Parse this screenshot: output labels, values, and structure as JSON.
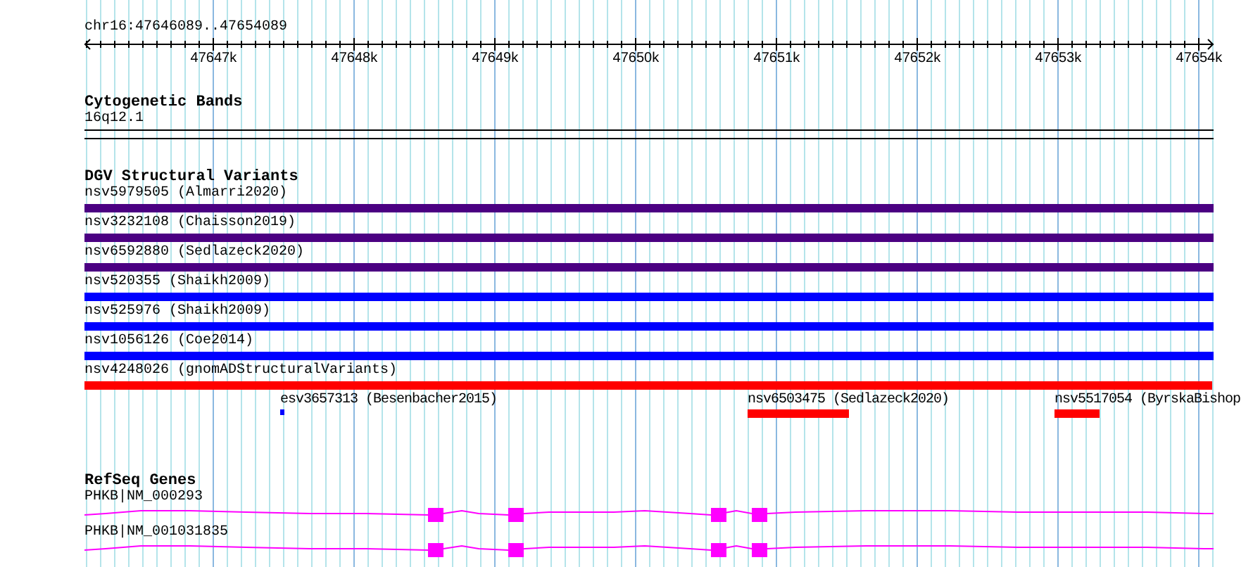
{
  "scale": {
    "location": "chr16:47646089..47654089",
    "ticks": [
      "47647k",
      "47648k",
      "47649k",
      "47650k",
      "47651k",
      "47652k",
      "47653k",
      "47654k"
    ]
  },
  "tracks": [
    {
      "kind": "cytoband",
      "title": "Cytogenetic Bands",
      "bands": [
        {
          "label": "16q12.1"
        }
      ]
    },
    {
      "kind": "variants",
      "title": "DGV Structural Variants",
      "rows": [
        [
          {
            "label": "nsv5979505 (Almarri2020)",
            "color": "#4b0082"
          }
        ],
        [
          {
            "label": "nsv3232108 (Chaisson2019)",
            "color": "#4b0082"
          }
        ],
        [
          {
            "label": "nsv6592880 (Sedlazeck2020)",
            "color": "#4b0082"
          }
        ],
        [
          {
            "label": "nsv520355 (Shaikh2009)",
            "color": "#0000ff"
          }
        ],
        [
          {
            "label": "nsv525976 (Shaikh2009)",
            "color": "#0000ff"
          }
        ],
        [
          {
            "label": "nsv1056126 (Coe2014)",
            "color": "#0000ff"
          }
        ],
        [
          {
            "label": "nsv4248026 (gnomADStructuralVariants)",
            "color": "#ff0000"
          }
        ],
        [
          {
            "label": "esv3657313 (Besenbacher2015)",
            "color": "#0000ff"
          },
          {
            "label": "nsv6503475 (Sedlazeck2020)",
            "color": "#ff0000"
          },
          {
            "label": "nsv5517054 (ByrskaBishop",
            "color": "#ff0000"
          }
        ]
      ]
    },
    {
      "kind": "genes",
      "title": "RefSeq Genes",
      "genes": [
        {
          "label": "PHKB|NM_000293"
        },
        {
          "label": "PHKB|NM_001031835"
        }
      ]
    }
  ]
}
